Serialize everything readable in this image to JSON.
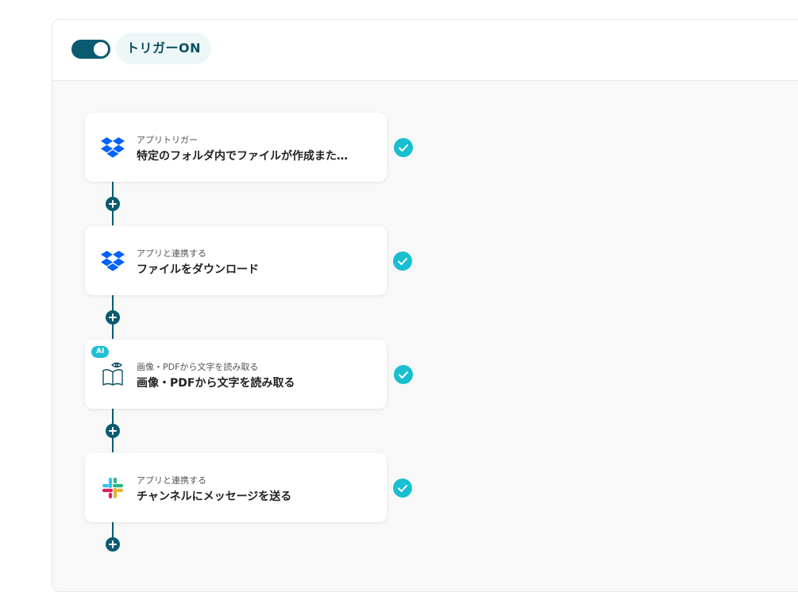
{
  "trigger": {
    "label": "トリガーON",
    "enabled": true
  },
  "steps": [
    {
      "sub": "アプリトリガー",
      "title": "特定のフォルダ内でファイルが作成また…",
      "icon": "dropbox-icon",
      "status": "done"
    },
    {
      "sub": "アプリと連携する",
      "title": "ファイルをダウンロード",
      "icon": "dropbox-icon",
      "status": "done"
    },
    {
      "sub": "画像・PDFから文字を読み取る",
      "title": "画像・PDFから文字を読み取る",
      "icon": "ocr-book-icon",
      "badge": "AI",
      "status": "done"
    },
    {
      "sub": "アプリと連携する",
      "title": "チャンネルにメッセージを送る",
      "icon": "slack-icon",
      "status": "done"
    }
  ],
  "colors": {
    "primary": "#0b5b70",
    "check": "#18bfd0",
    "canvas": "#f8f8f8",
    "dropbox": "#0061fe"
  }
}
